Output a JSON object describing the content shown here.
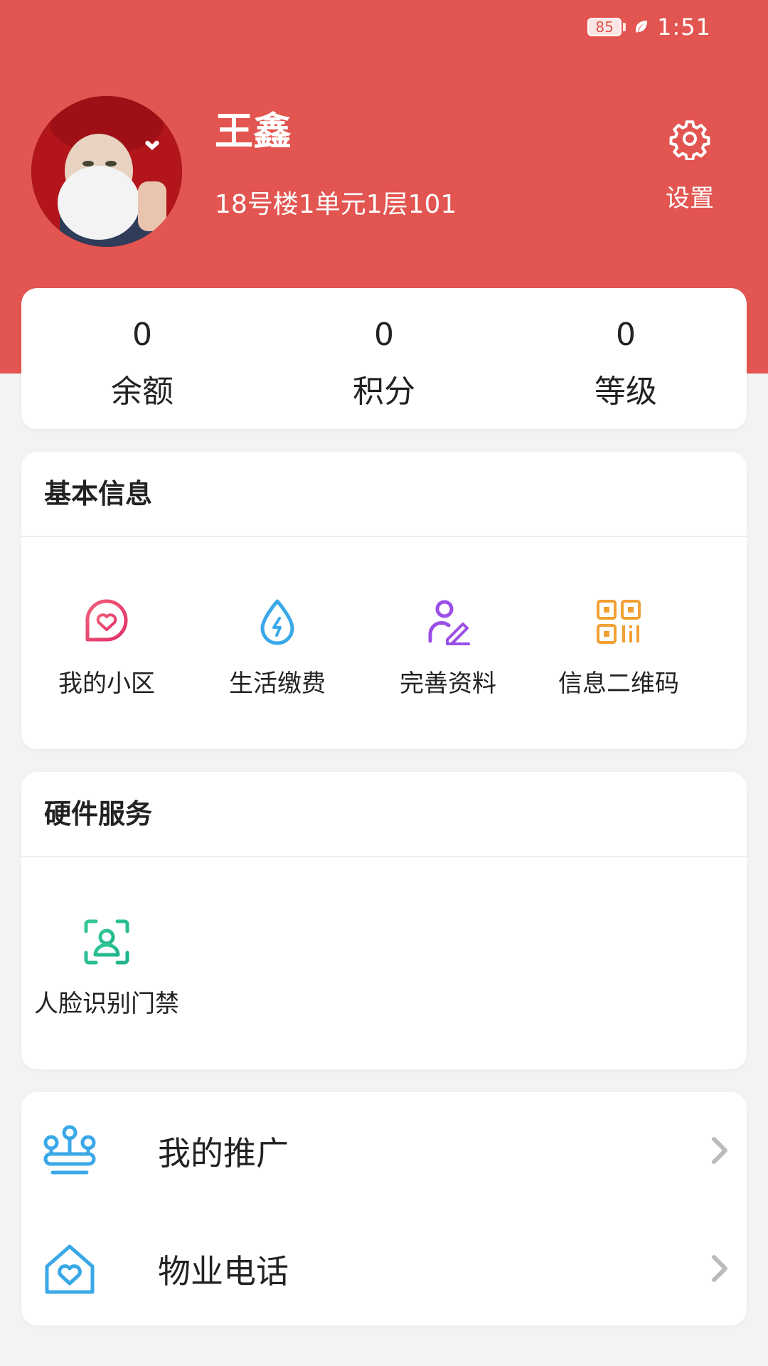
{
  "status_bar": {
    "battery": "85",
    "time": "1:51"
  },
  "profile": {
    "name": "王鑫",
    "address": "18号楼1单元1层101",
    "settings_label": "设置"
  },
  "stats": [
    {
      "value": "0",
      "label": "余额"
    },
    {
      "value": "0",
      "label": "积分"
    },
    {
      "value": "0",
      "label": "等级"
    }
  ],
  "basic_info": {
    "title": "基本信息",
    "items": [
      {
        "label": "我的小区",
        "icon": "heart-chat-icon"
      },
      {
        "label": "生活缴费",
        "icon": "water-drop-bolt-icon"
      },
      {
        "label": "完善资料",
        "icon": "person-edit-icon"
      },
      {
        "label": "信息二维码",
        "icon": "qr-code-icon"
      }
    ]
  },
  "hardware": {
    "title": "硬件服务",
    "items": [
      {
        "label": "人脸识别门禁",
        "icon": "face-scan-icon"
      }
    ]
  },
  "menu": [
    {
      "label": "我的推广",
      "icon": "share-nodes-icon"
    },
    {
      "label": "物业电话",
      "icon": "house-heart-icon"
    }
  ],
  "colors": {
    "brand_red": "#e25550",
    "background": "#f3f3f4",
    "card": "#ffffff"
  }
}
